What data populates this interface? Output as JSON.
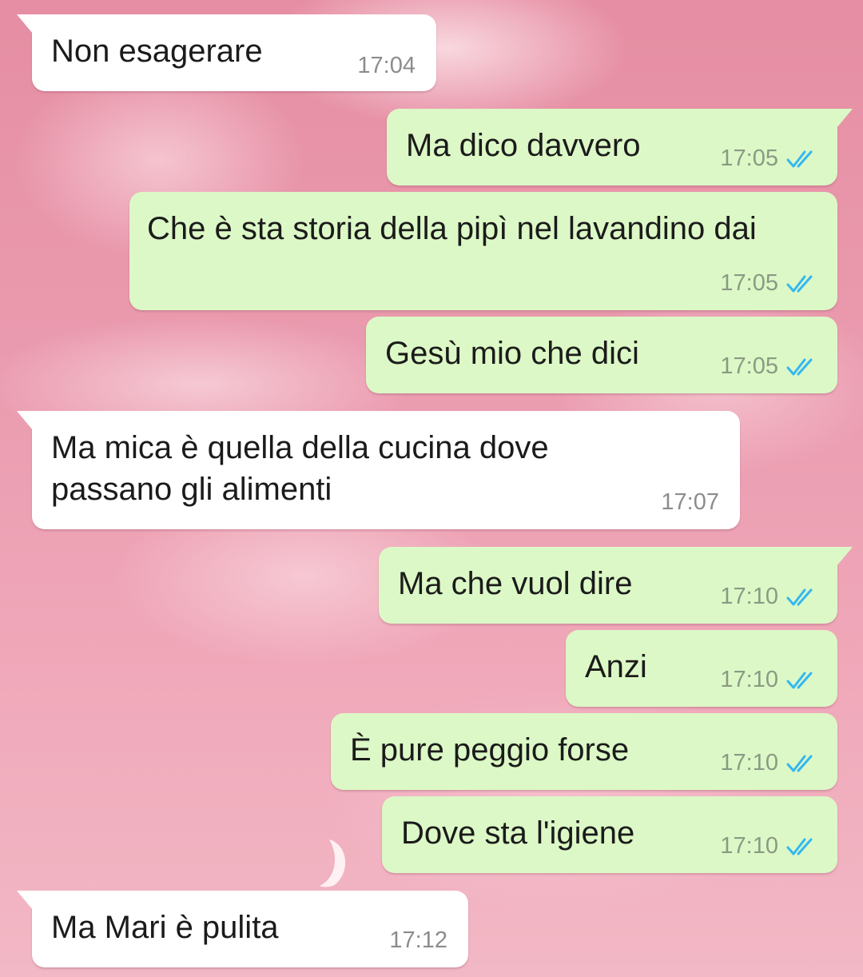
{
  "chat": {
    "messages": [
      {
        "direction": "incoming",
        "text": "Non esagerare",
        "time": "17:04"
      },
      {
        "direction": "outgoing",
        "text": "Ma dico davvero",
        "time": "17:05",
        "status": "read"
      },
      {
        "direction": "outgoing",
        "text": "Che è sta storia della pipì nel lavandino dai",
        "time": "17:05",
        "status": "read"
      },
      {
        "direction": "outgoing",
        "text": "Gesù mio che dici",
        "time": "17:05",
        "status": "read"
      },
      {
        "direction": "incoming",
        "text": "Ma mica è quella della cucina dove passano gli alimenti",
        "time": "17:07"
      },
      {
        "direction": "outgoing",
        "text": "Ma che vuol dire",
        "time": "17:10",
        "status": "read"
      },
      {
        "direction": "outgoing",
        "text": "Anzi",
        "time": "17:10",
        "status": "read"
      },
      {
        "direction": "outgoing",
        "text": "È pure peggio forse",
        "time": "17:10",
        "status": "read"
      },
      {
        "direction": "outgoing",
        "text": "Dove sta l'igiene",
        "time": "17:10",
        "status": "read"
      },
      {
        "direction": "incoming",
        "text": "Ma Mari è pulita",
        "time": "17:12"
      }
    ]
  },
  "colors": {
    "incoming_bubble": "#ffffff",
    "outgoing_bubble": "#dcf8c6",
    "read_ticks": "#34b7f1",
    "timestamp": "#8c8c8c",
    "wallpaper": "#ea9aae"
  },
  "icons": {
    "read_receipt": "double-check-icon",
    "wallpaper_moon": "crescent-moon-icon"
  }
}
